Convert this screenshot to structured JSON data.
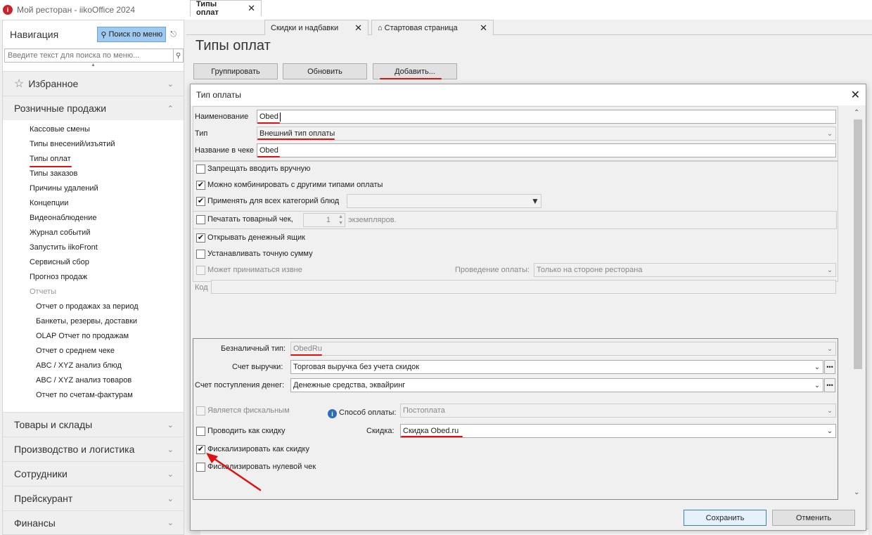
{
  "window": {
    "title": "Мой ресторан - iikoOffice 2024",
    "logo_text": "i"
  },
  "nav": {
    "title": "Навигация",
    "search_button": "Поиск по меню",
    "search_placeholder": "Введите текст для поиска по меню...",
    "sections": {
      "favorites": "Избранное",
      "retail": "Розничные продажи",
      "goods": "Товары и склады",
      "production": "Производство и логистика",
      "staff": "Сотрудники",
      "pricelist": "Прейскурант",
      "finance": "Финансы"
    },
    "retail_items": [
      "Кассовые смены",
      "Типы внесений/изъятий",
      "Типы оплат",
      "Типы заказов",
      "Причины удалений",
      "Концепции",
      "Видеонаблюдение",
      "Журнал событий",
      "Запустить iikoFront",
      "Сервисный сбор",
      "Прогноз продаж",
      "Отчеты"
    ],
    "report_items": [
      "Отчет о продажах за период",
      "Банкеты, резервы, доставки",
      "OLAP Отчет по продажам",
      "Отчет о среднем чеке",
      "ABC / XYZ анализ блюд",
      "ABC / XYZ анализ товаров",
      "Отчет по счетам-фактурам"
    ]
  },
  "tabs": [
    "Типы оплат",
    "Скидки и надбавки",
    "Стартовая страница"
  ],
  "page": {
    "title": "Типы оплат",
    "group_button": "Группировать",
    "refresh_button": "Обновить",
    "add_button": "Добавить..."
  },
  "dialog": {
    "title": "Тип оплаты",
    "name_label": "Наименование",
    "name_value": "Obed",
    "type_label": "Тип",
    "type_value": "Внешний тип оплаты",
    "receipt_label": "Название в чеке",
    "receipt_value": "Obed",
    "cb_forbid_manual": "Запрещать вводить вручную",
    "cb_combine": "Можно комбинировать с другими типами оплаты",
    "cb_all_categories": "Применять для всех категорий блюд",
    "cb_print_receipt": "Печатать товарный чек,",
    "copies_value": "1",
    "copies_label": "экземпляров.",
    "cb_open_drawer": "Открывать денежный ящик",
    "cb_exact_sum": "Устанавливать точную сумму",
    "cb_external": "Может приниматься извне",
    "processing_label": "Проведение оплаты:",
    "processing_value": "Только на стороне ресторана",
    "code_label": "Код",
    "noncash_label": "Безналичный тип:",
    "noncash_value": "ObedRu",
    "revenue_label": "Счет выручки:",
    "revenue_value": "Торговая выручка без учета скидок",
    "money_label": "Счет поступления денег:",
    "money_value": "Денежные средства, эквайринг",
    "cb_fiscal": "Является фискальным",
    "method_label": "Способ оплаты:",
    "method_value": "Постоплата",
    "cb_as_discount": "Проводить как скидку",
    "discount_label": "Скидка:",
    "discount_value": "Скидка Obed.ru",
    "cb_fiscal_discount": "Фискализировать как скидку",
    "cb_fiscal_zero": "Фискализировать нулевой чек",
    "save_button": "Сохранить",
    "cancel_button": "Отменить"
  },
  "colors": {
    "annotation": "#e01010",
    "accent": "#9fc9ef"
  }
}
